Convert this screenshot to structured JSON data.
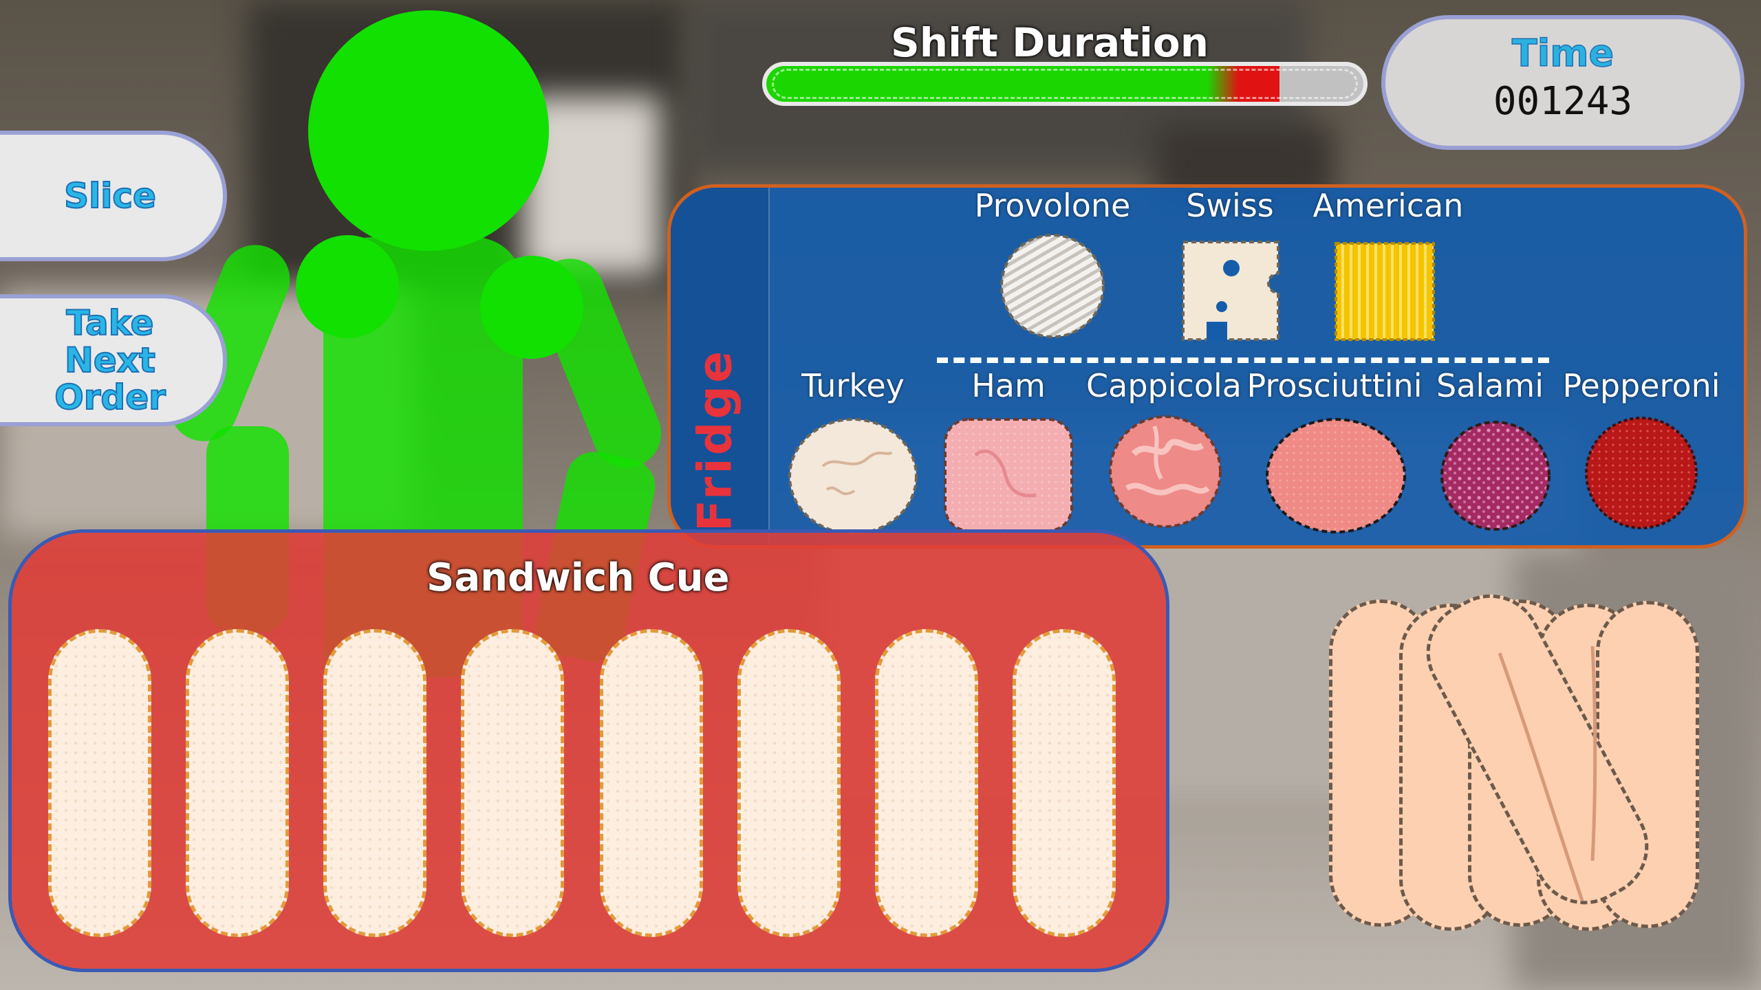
{
  "sidebar": {
    "slice_label": "Slice",
    "take_next_order_lines": [
      "Take",
      "Next",
      "Order"
    ]
  },
  "shift": {
    "title": "Shift Duration",
    "progress": 0.86,
    "fill_color": "#1bd600",
    "warning_color": "#e01212"
  },
  "timer": {
    "label": "Time",
    "value": "001243"
  },
  "fridge": {
    "label": "Fridge",
    "cheeses": [
      {
        "name": "Provolone",
        "icon": "provolone-icon"
      },
      {
        "name": "Swiss",
        "icon": "swiss-icon"
      },
      {
        "name": "American",
        "icon": "american-icon"
      }
    ],
    "meats": [
      {
        "name": "Turkey",
        "icon": "turkey-icon"
      },
      {
        "name": "Ham",
        "icon": "ham-icon"
      },
      {
        "name": "Cappicola",
        "icon": "cappicola-icon"
      },
      {
        "name": "Prosciuttini",
        "icon": "prosciuttini-icon"
      },
      {
        "name": "Salami",
        "icon": "salami-icon"
      },
      {
        "name": "Pepperoni",
        "icon": "pepperoni-icon"
      }
    ]
  },
  "sandwich_cue": {
    "title": "Sandwich Cue",
    "slots": 8
  },
  "colors": {
    "player": "#12e000",
    "fridge_panel": "#155daa",
    "cue_panel": "#e03e38",
    "button_text": "#29b6e6"
  }
}
